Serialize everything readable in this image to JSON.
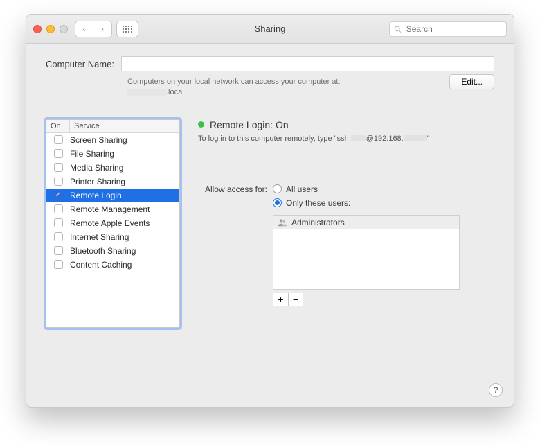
{
  "window_title": "Sharing",
  "search_placeholder": "Search",
  "computer_name_label": "Computer Name:",
  "network_hint": "Computers on your local network can access your computer at:",
  "network_address_suffix": ".local",
  "edit_label": "Edit...",
  "svc_headers": {
    "on": "On",
    "service": "Service"
  },
  "services": [
    {
      "label": "Screen Sharing",
      "on": false,
      "selected": false
    },
    {
      "label": "File Sharing",
      "on": false,
      "selected": false
    },
    {
      "label": "Media Sharing",
      "on": false,
      "selected": false
    },
    {
      "label": "Printer Sharing",
      "on": false,
      "selected": false
    },
    {
      "label": "Remote Login",
      "on": true,
      "selected": true
    },
    {
      "label": "Remote Management",
      "on": false,
      "selected": false
    },
    {
      "label": "Remote Apple Events",
      "on": false,
      "selected": false
    },
    {
      "label": "Internet Sharing",
      "on": false,
      "selected": false
    },
    {
      "label": "Bluetooth Sharing",
      "on": false,
      "selected": false
    },
    {
      "label": "Content Caching",
      "on": false,
      "selected": false
    }
  ],
  "status_title": "Remote Login: On",
  "ssh_prefix": "To log in to this computer remotely, type \"ssh ",
  "ssh_host": "@192.168.",
  "ssh_suffix": "\"",
  "access_label": "Allow access for:",
  "radio_all": "All users",
  "radio_only": "Only these users:",
  "user_entry": "Administrators",
  "plus": "+",
  "minus": "−",
  "help": "?"
}
